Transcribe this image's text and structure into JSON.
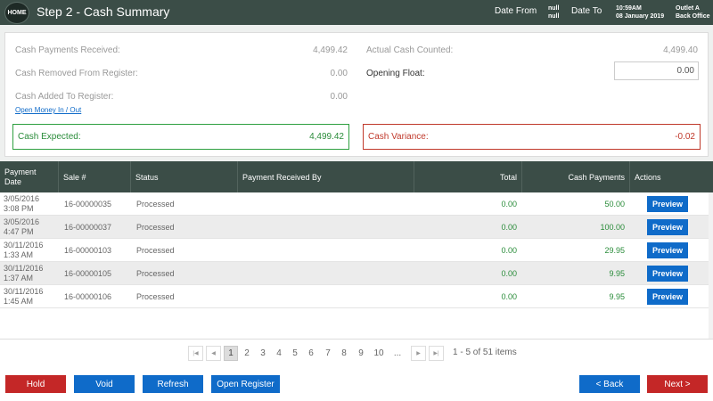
{
  "header": {
    "home_label": "HOME",
    "title": "Step 2 - Cash Summary",
    "date_from_label": "Date From",
    "date_from_values": [
      "null",
      "null"
    ],
    "date_to_label": "Date To",
    "time": "10:59AM",
    "date": "08 January 2019",
    "outlet": "Outlet A",
    "office": "Back Office"
  },
  "summary": {
    "cash_payments_label": "Cash Payments Received:",
    "cash_payments_value": "4,499.42",
    "cash_removed_label": "Cash Removed From Register:",
    "cash_removed_value": "0.00",
    "cash_added_label": "Cash Added To Register:",
    "cash_added_value": "0.00",
    "money_link": "Open Money In / Out",
    "actual_counted_label": "Actual Cash Counted:",
    "actual_counted_value": "4,499.40",
    "opening_float_label": "Opening Float:",
    "opening_float_value": "0.00",
    "cash_expected_label": "Cash Expected:",
    "cash_expected_value": "4,499.42",
    "cash_variance_label": "Cash Variance:",
    "cash_variance_value": "-0.02"
  },
  "table": {
    "headers": {
      "date": "Payment Date",
      "sale": "Sale #",
      "status": "Status",
      "received_by": "Payment Received By",
      "total": "Total",
      "cash": "Cash Payments",
      "actions": "Actions"
    },
    "preview_label": "Preview",
    "rows": [
      {
        "date": "3/05/2016",
        "time": "3:08 PM",
        "sale": "16-00000035",
        "status": "Processed",
        "received_by": "",
        "total": "0.00",
        "cash": "50.00"
      },
      {
        "date": "3/05/2016",
        "time": "4:47 PM",
        "sale": "16-00000037",
        "status": "Processed",
        "received_by": "",
        "total": "0.00",
        "cash": "100.00"
      },
      {
        "date": "30/11/2016",
        "time": "1:33 AM",
        "sale": "16-00000103",
        "status": "Processed",
        "received_by": "",
        "total": "0.00",
        "cash": "29.95"
      },
      {
        "date": "30/11/2016",
        "time": "1:37 AM",
        "sale": "16-00000105",
        "status": "Processed",
        "received_by": "",
        "total": "0.00",
        "cash": "9.95"
      },
      {
        "date": "30/11/2016",
        "time": "1:45 AM",
        "sale": "16-00000106",
        "status": "Processed",
        "received_by": "",
        "total": "0.00",
        "cash": "9.95"
      }
    ]
  },
  "pager": {
    "first": "|◀",
    "prev": "◀",
    "pages": [
      "1",
      "2",
      "3",
      "4",
      "5",
      "6",
      "7",
      "8",
      "9",
      "10",
      "..."
    ],
    "next": "▶",
    "last": "▶|",
    "info": "1 - 5 of 51 items"
  },
  "footer": {
    "hold": "Hold",
    "void": "Void",
    "refresh": "Refresh",
    "open_register": "Open Register",
    "back": "< Back",
    "next": "Next >"
  },
  "colors": {
    "header_bg": "#3b4d47",
    "accent_blue": "#0f6bc9",
    "danger_red": "#c42727",
    "positive_green": "#2a8c3a"
  }
}
